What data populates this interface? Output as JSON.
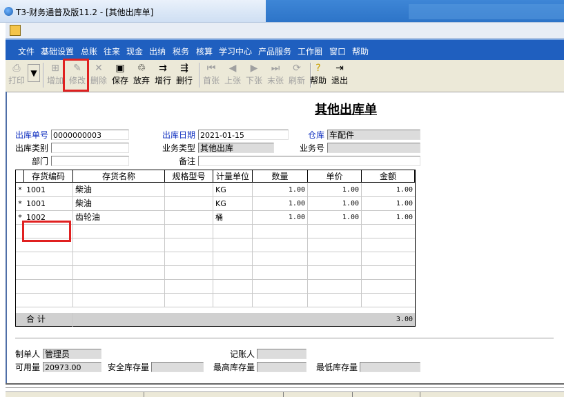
{
  "window": {
    "title": "T3-财务通普及版11.2 - [其他出库单]"
  },
  "menu": [
    "文件",
    "基础设置",
    "总账",
    "往来",
    "现金",
    "出纳",
    "税务",
    "核算",
    "学习中心",
    "产品服务",
    "工作圈",
    "窗口",
    "帮助"
  ],
  "toolbar": [
    {
      "label": "打印",
      "icon": "print-icon",
      "enabled": false
    },
    {
      "label": "增加",
      "icon": "add-icon",
      "enabled": false
    },
    {
      "label": "修改",
      "icon": "edit-icon",
      "enabled": false
    },
    {
      "label": "删除",
      "icon": "delete-icon",
      "enabled": false
    },
    {
      "label": "保存",
      "icon": "save-icon",
      "enabled": true
    },
    {
      "label": "放弃",
      "icon": "discard-icon",
      "enabled": true
    },
    {
      "label": "增行",
      "icon": "add-row-icon",
      "enabled": true
    },
    {
      "label": "删行",
      "icon": "delete-row-icon",
      "enabled": true
    },
    {
      "label": "首张",
      "icon": "first-icon",
      "enabled": false
    },
    {
      "label": "上张",
      "icon": "prev-icon",
      "enabled": false
    },
    {
      "label": "下张",
      "icon": "next-icon",
      "enabled": false
    },
    {
      "label": "末张",
      "icon": "last-icon",
      "enabled": false
    },
    {
      "label": "刷新",
      "icon": "refresh-icon",
      "enabled": false
    },
    {
      "label": "帮助",
      "icon": "help-icon",
      "enabled": true
    },
    {
      "label": "退出",
      "icon": "exit-icon",
      "enabled": true
    }
  ],
  "form": {
    "title": "其他出库单",
    "out_no_label": "出库单号",
    "out_no": "0000000003",
    "out_date_label": "出库日期",
    "out_date": "2021-01-15",
    "warehouse_label": "仓库",
    "warehouse": "车配件",
    "out_type_label": "出库类别",
    "out_type": "",
    "biz_type_label": "业务类型",
    "biz_type": "其他出库",
    "biz_no_label": "业务号",
    "biz_no": "",
    "dept_label": "部门",
    "dept": "",
    "remark_label": "备注",
    "remark": ""
  },
  "grid": {
    "columns": [
      "存货编码",
      "存货名称",
      "规格型号",
      "计量单位",
      "数量",
      "单价",
      "金额"
    ],
    "rows": [
      {
        "mark": "*",
        "code": "1001",
        "name": "柴油",
        "spec": "",
        "unit": "KG",
        "qty": "1.00",
        "price": "1.00",
        "amount": "1.00"
      },
      {
        "mark": "*",
        "code": "1001",
        "name": "柴油",
        "spec": "",
        "unit": "KG",
        "qty": "1.00",
        "price": "1.00",
        "amount": "1.00"
      },
      {
        "mark": "*",
        "code": "1002",
        "name": "齿轮油",
        "spec": "",
        "unit": "桶",
        "qty": "1.00",
        "price": "1.00",
        "amount": "1.00"
      }
    ],
    "total_label": "合  计",
    "total_amount": "3.00"
  },
  "footer": {
    "maker_label": "制单人",
    "maker": "管理员",
    "bookkeeper_label": "记账人",
    "bookkeeper": "",
    "available_label": "可用量",
    "available": "20973.00",
    "safety_label": "安全库存量",
    "safety": "",
    "max_label": "最高库存量",
    "max": "",
    "min_label": "最低库存量",
    "min": ""
  },
  "colors": {
    "menubar": "#1f5fbf",
    "highlight": "#e02020",
    "label_blue": "#1030c0"
  }
}
